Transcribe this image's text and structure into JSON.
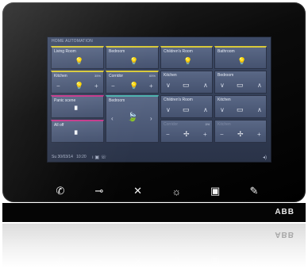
{
  "screen": {
    "title": "HOME AUTOMATION",
    "status_date": "Su 30/03/14",
    "status_time": "10:20",
    "status_icons": "ı  ▣  ☏",
    "volume_icon": "◂)"
  },
  "tiles": {
    "living_room": "Living Room",
    "bedroom1": "Bedroom",
    "childrens_room1": "Children's Room",
    "bathroom": "Bathroom",
    "kitchen1": "Kitchen",
    "kitchen1_val": "35%",
    "corridor1": "Corridor",
    "corridor1_val": "65%",
    "kitchen2": "Kitchen",
    "bedroom2": "Bedroom",
    "panic_scene": "Panic scene",
    "bedroom3": "Bedroom",
    "childrens_room2": "Children's Room",
    "kitchen3": "Kitchen",
    "all_off": "All off",
    "corridor2": "Corridor",
    "corridor2_val": "2/4",
    "kitchen4": "Kitchen"
  },
  "glyphs": {
    "bulb": "💡",
    "minus": "−",
    "plus": "+",
    "chevron_down": "∨",
    "chevron_up": "∧",
    "chevron_left": "‹",
    "chevron_right": "›",
    "blind": "▭",
    "scene": "▘",
    "fan": "✢",
    "leaf": "🍃"
  },
  "buttons": {
    "phone": "✆",
    "key": "⊸",
    "mute": "✕",
    "light": "☼",
    "display": "▣",
    "tool": "✎"
  },
  "brand": "ABB"
}
